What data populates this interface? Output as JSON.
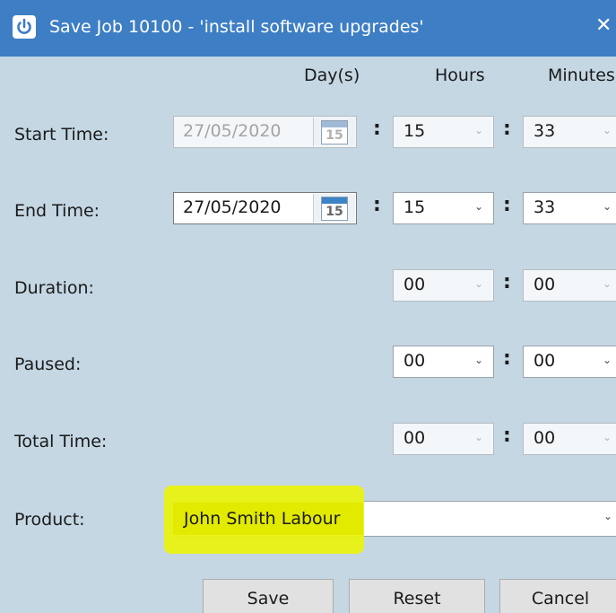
{
  "window": {
    "title": "Save Job 10100 - 'install software upgrades'",
    "icon": "power-icon",
    "close_glyph": "✕"
  },
  "columns": {
    "days": "Day(s)",
    "hours": "Hours",
    "minutes": "Minutes"
  },
  "rows": {
    "start": {
      "label": "Start Time:",
      "date": "27/05/2020",
      "hours": "15",
      "minutes": "33",
      "enabled": false
    },
    "end": {
      "label": "End Time:",
      "date": "27/05/2020",
      "hours": "15",
      "minutes": "33",
      "enabled": true
    },
    "duration": {
      "label": "Duration:",
      "hours": "00",
      "minutes": "00",
      "enabled": false
    },
    "paused": {
      "label": "Paused:",
      "hours": "00",
      "minutes": "00",
      "enabled": true
    },
    "total": {
      "label": "Total Time:",
      "hours": "00",
      "minutes": "00",
      "enabled": false
    }
  },
  "calendar_day": "15",
  "colon": ":",
  "arrow_glyph": "⌄",
  "product": {
    "label": "Product:",
    "value": "John Smith Labour"
  },
  "buttons": {
    "save": "Save",
    "reset": "Reset",
    "cancel": "Cancel"
  },
  "colors": {
    "titlebar": "#3d7ec4",
    "background": "#c4d7e3",
    "highlight": "#e9f211"
  }
}
